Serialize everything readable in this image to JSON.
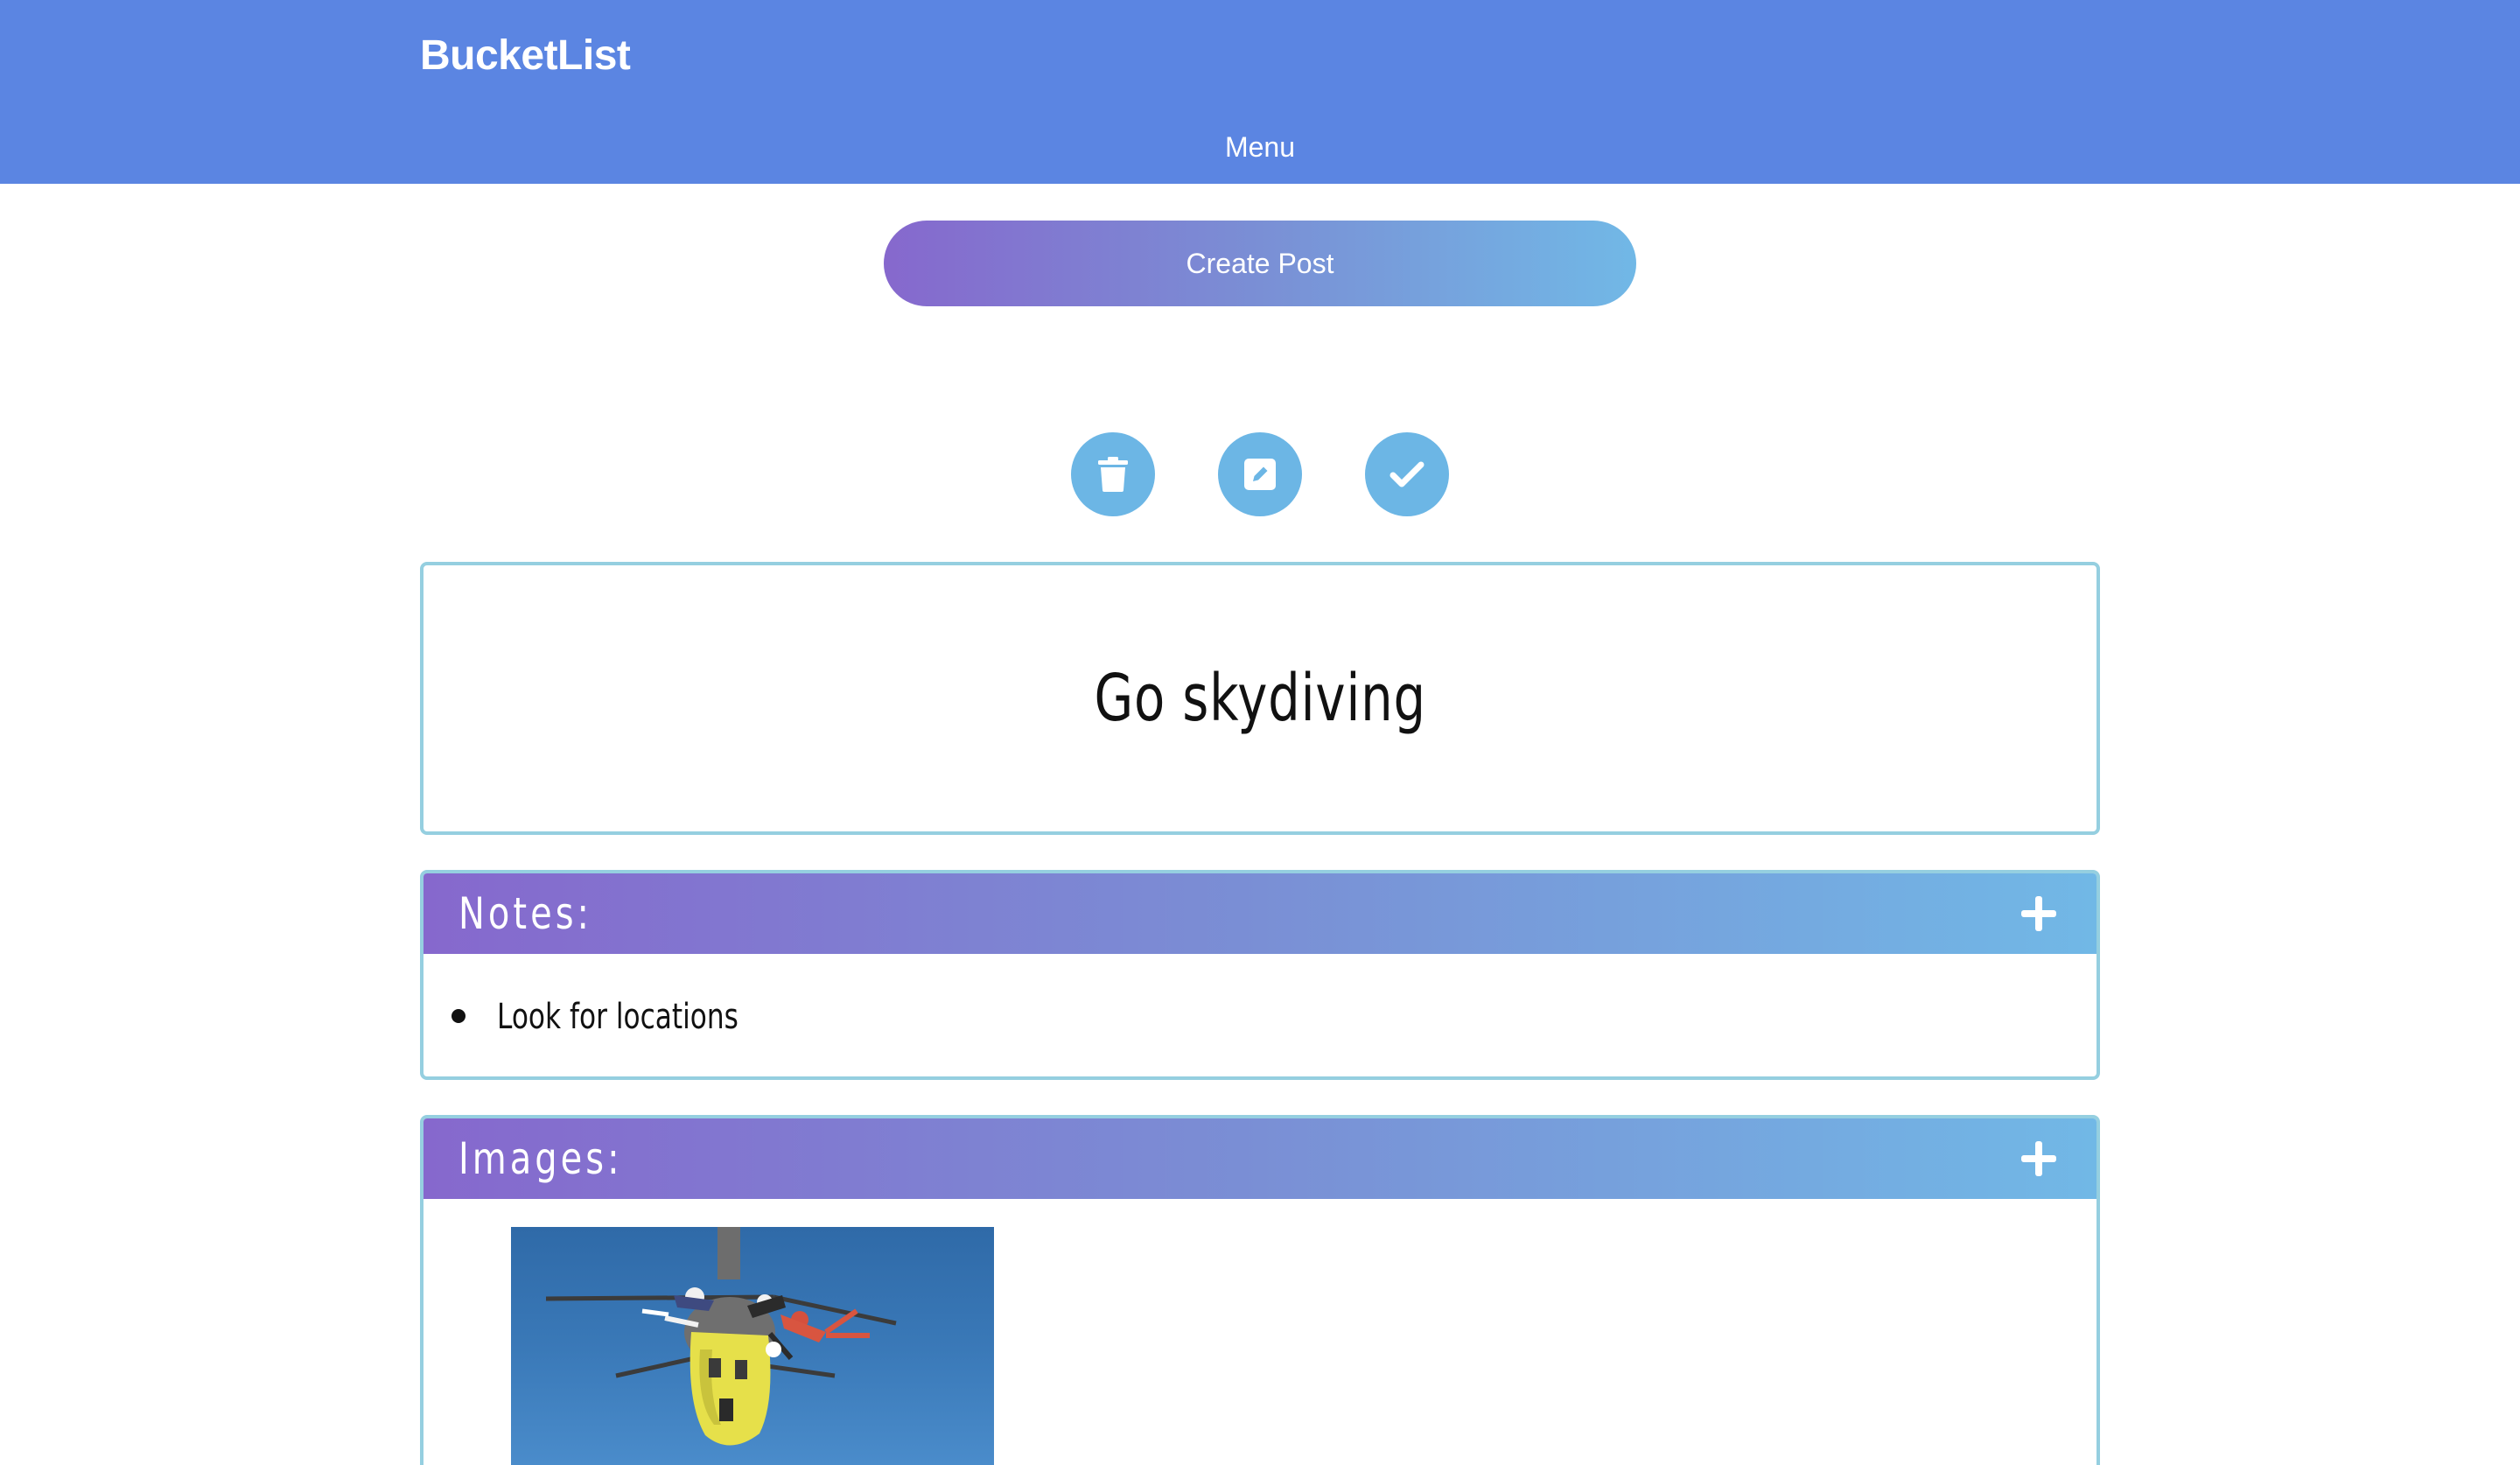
{
  "navbar": {
    "brand": "BucketList",
    "menu_label": "Menu"
  },
  "create_post_label": "Create Post",
  "actions": {
    "delete_icon": "trash-icon",
    "edit_icon": "edit-icon",
    "complete_icon": "check-icon"
  },
  "post": {
    "title": "Go skydiving"
  },
  "notes": {
    "title": "Notes:",
    "items": [
      "Look for locations"
    ]
  },
  "images": {
    "title": "Images:",
    "image_subject": "skydivers jumping from a yellow helicopter"
  },
  "colors": {
    "navbar": "#5b85e2",
    "gradient_start": "#8668cd",
    "gradient_end": "#71b8e6",
    "action_button": "#6cb6e5",
    "card_border": "#95cfe0"
  }
}
